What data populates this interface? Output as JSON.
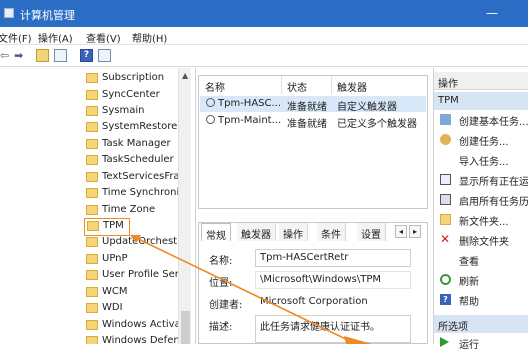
{
  "window": {
    "title": "计算机管理",
    "minimize_glyph": "—"
  },
  "menu": [
    "文件(F)",
    "操作(A)",
    "查看(V)",
    "帮助(H)"
  ],
  "toolbar": {
    "back_glyph": "⇦",
    "forward_glyph": "➡",
    "help_label": "?"
  },
  "tree": {
    "items": [
      "Subscription",
      "SyncCenter",
      "Sysmain",
      "SystemRestore",
      "Task Manager",
      "TaskScheduler",
      "TextServicesFrai",
      "Time Synchroniz",
      "Time Zone",
      "TPM",
      "UpdateOrchestr",
      "UPnP",
      "User Profile Ser",
      "WCM",
      "WDI",
      "Windows Activa",
      "Windows Defen"
    ],
    "selected": "TPM"
  },
  "task_list": {
    "columns": [
      "名称",
      "状态",
      "触发器"
    ],
    "rows": [
      {
        "name": "Tpm-HASC...",
        "status": "准备就绪",
        "trigger": "自定义触发器",
        "selected": true
      },
      {
        "name": "Tpm-Maint...",
        "status": "准备就绪",
        "trigger": "已定义多个触发器",
        "selected": false
      }
    ]
  },
  "detail": {
    "tabs": [
      "常规",
      "触发器",
      "操作",
      "条件",
      "设置"
    ],
    "active_tab": "常规",
    "nav_left": "◂",
    "nav_right": "▸",
    "fields": [
      {
        "label": "名称:",
        "value": "Tpm-HASCertRetr"
      },
      {
        "label": "位置:",
        "value": "\\Microsoft\\Windows\\TPM"
      },
      {
        "label": "创建者:",
        "value": "Microsoft Corporation"
      },
      {
        "label": "描述:",
        "value": "此任务请求健康认证证书。"
      }
    ]
  },
  "actions": {
    "header": "操作",
    "section1": "TPM",
    "items": [
      {
        "label": "创建基本任务...",
        "icon": "wizard-icon"
      },
      {
        "label": "创建任务...",
        "icon": "create-task-icon"
      },
      {
        "label": "导入任务...",
        "icon": ""
      },
      {
        "label": "显示所有正在运",
        "icon": "running-tasks-icon"
      },
      {
        "label": "启用所有任务历",
        "icon": "history-icon"
      },
      {
        "label": "新文件夹...",
        "icon": "folder-icon"
      },
      {
        "label": "删除文件夹",
        "icon": "delete-icon"
      },
      {
        "label": "查看",
        "icon": ""
      },
      {
        "label": "刷新",
        "icon": "refresh-icon"
      },
      {
        "label": "帮助",
        "icon": "help-icon"
      }
    ],
    "section2": "所选项",
    "section2_items": [
      {
        "label": "运行",
        "icon": "run-icon"
      }
    ]
  },
  "colors": {
    "titlebar": "#2b6cc4",
    "selection": "#d9e8f8",
    "arrow": "#f08a24"
  }
}
